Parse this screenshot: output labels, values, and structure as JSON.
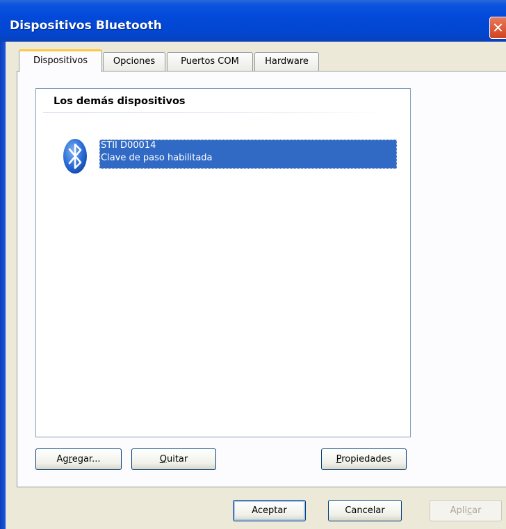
{
  "window": {
    "title": "Dispositivos Bluetooth"
  },
  "tabs": [
    {
      "label": "Dispositivos",
      "active": true
    },
    {
      "label": "Opciones",
      "active": false
    },
    {
      "label": "Puertos COM",
      "active": false
    },
    {
      "label": "Hardware",
      "active": false
    }
  ],
  "device_list": {
    "group_header": "Los demás dispositivos",
    "items": [
      {
        "name": "STII D00014",
        "status": "Clave de paso habilitada",
        "icon": "bluetooth-icon",
        "selected": true
      }
    ]
  },
  "panel_buttons": {
    "add": {
      "before": "Ag",
      "mnemonic": "r",
      "after": "egar..."
    },
    "remove": {
      "before": "",
      "mnemonic": "Q",
      "after": "uitar"
    },
    "properties": {
      "before": "",
      "mnemonic": "P",
      "after": "ropiedades"
    }
  },
  "dialog_buttons": {
    "ok": "Aceptar",
    "cancel": "Cancelar",
    "apply": {
      "before": "Apli",
      "mnemonic": "c",
      "after": "ar",
      "disabled": true
    }
  },
  "colors": {
    "title_bar": "#0349d8",
    "selection": "#316ac5",
    "tab_highlight": "#ffc83c",
    "dialog_bg": "#ece9d8"
  }
}
